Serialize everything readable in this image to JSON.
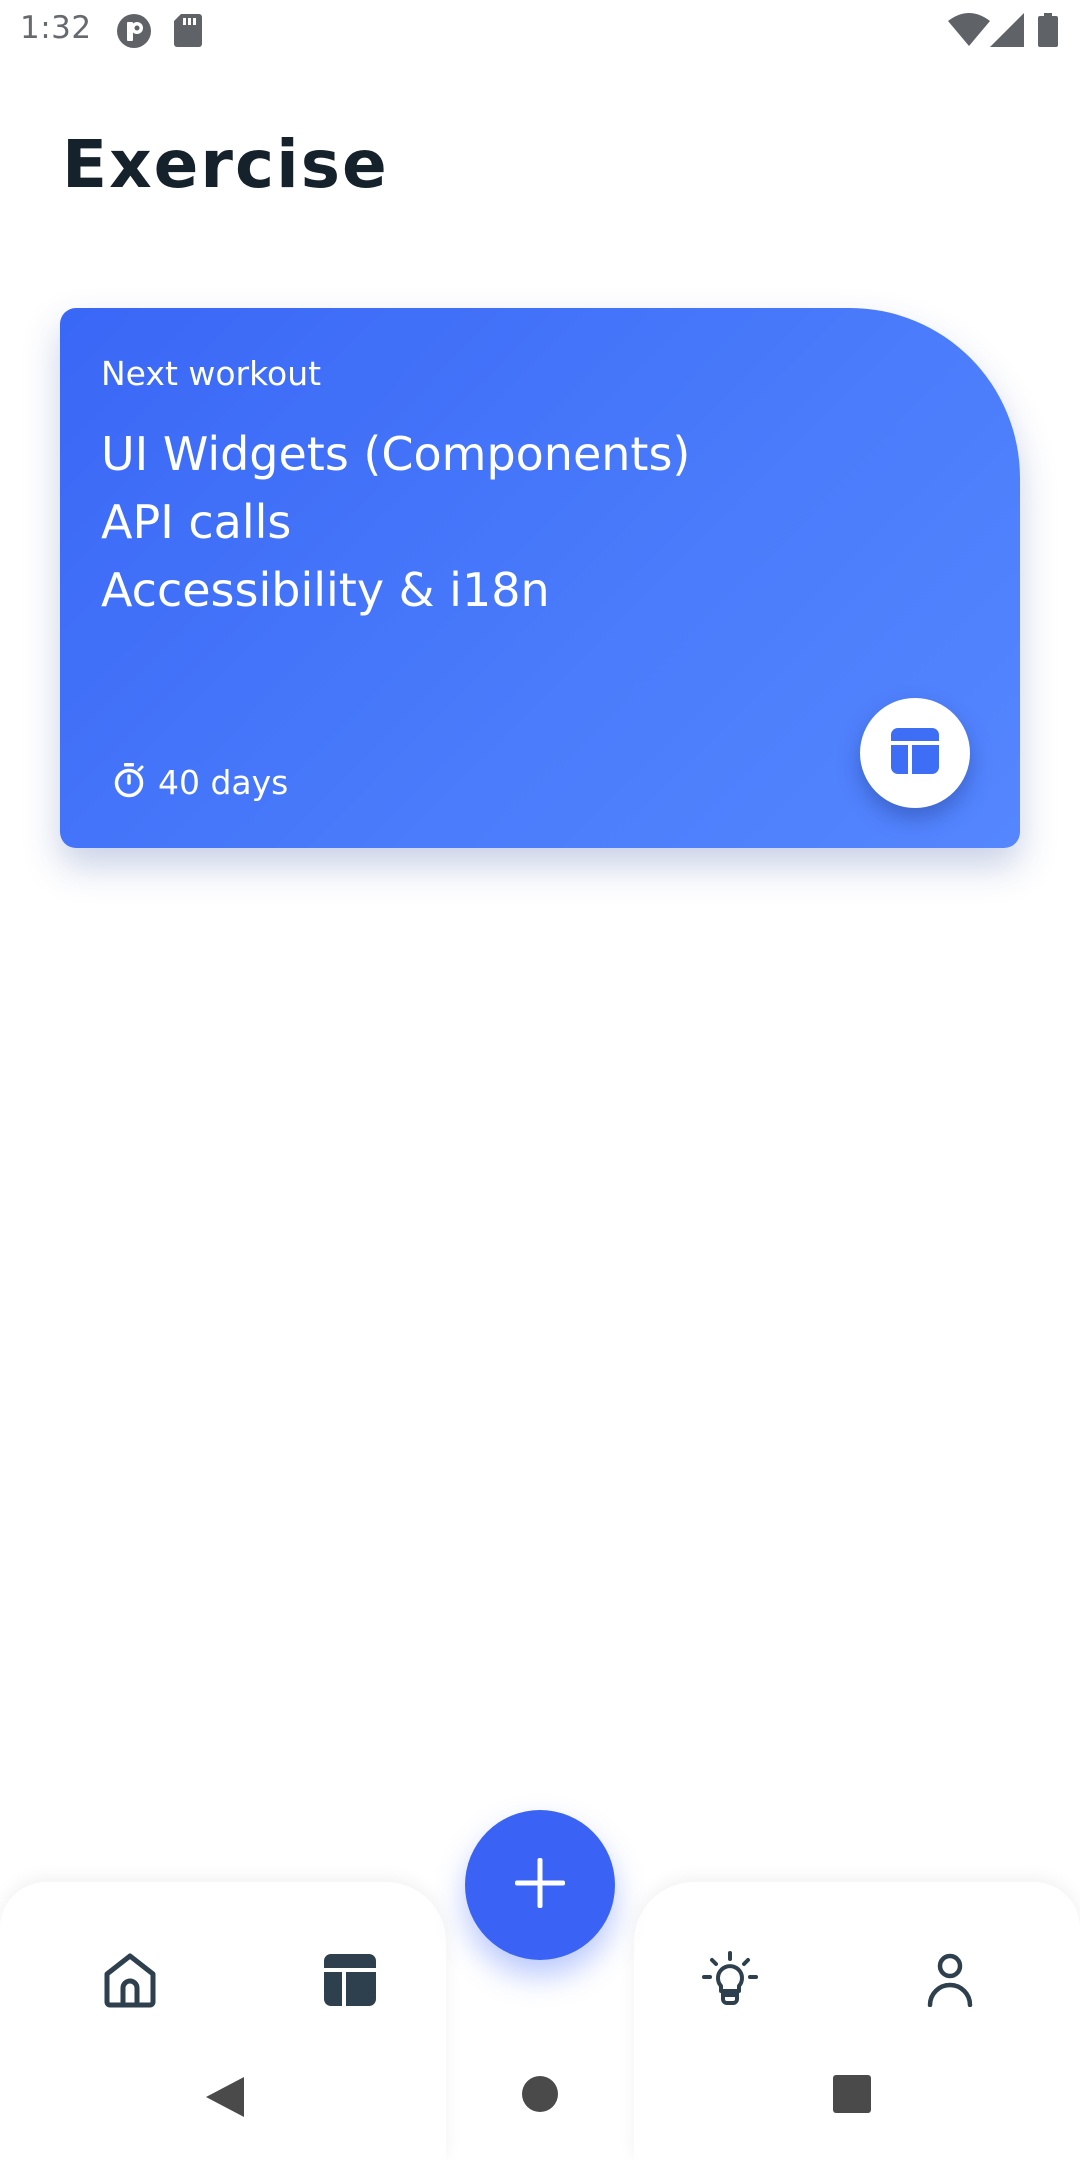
{
  "status_bar": {
    "time": "1:32",
    "left_icons": [
      "app-notification-icon",
      "sd-card-icon"
    ],
    "right_icons": [
      "wifi-icon",
      "cell-signal-icon",
      "battery-icon"
    ]
  },
  "page": {
    "title": "Exercise"
  },
  "card": {
    "kicker": "Next workout",
    "topics": [
      "UI Widgets (Components)",
      "API calls",
      "Accessibility & i18n"
    ],
    "timer_label": "40 days",
    "action_icon": "dashboard-icon",
    "gradient_start": "#3a67f6",
    "gradient_end": "#5586ff"
  },
  "bottom_nav": {
    "items": [
      {
        "icon": "home-icon"
      },
      {
        "icon": "dashboard-icon"
      },
      {
        "icon": "lightbulb-icon"
      },
      {
        "icon": "profile-icon"
      }
    ],
    "fab_icon": "plus-icon",
    "accent": "#3a63f5",
    "icon_color": "#2e3f4e"
  },
  "system_nav": {
    "buttons": [
      "back-icon",
      "home-circle-icon",
      "recents-icon"
    ]
  }
}
